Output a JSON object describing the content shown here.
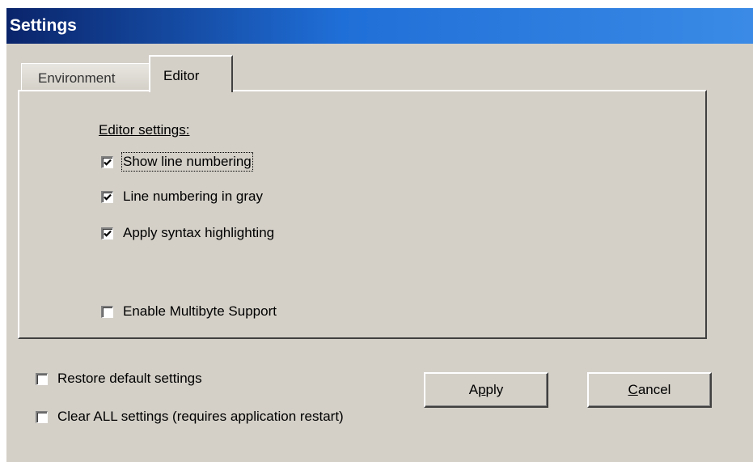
{
  "window": {
    "title": "Settings"
  },
  "tabs": [
    {
      "label": "Environment",
      "selected": false
    },
    {
      "label": "Editor",
      "selected": true
    }
  ],
  "editor_panel": {
    "group_label": "Editor settings:",
    "options": [
      {
        "label": "Show line numbering",
        "checked": true
      },
      {
        "label": "Line numbering in gray",
        "checked": true
      },
      {
        "label": "Apply syntax highlighting",
        "checked": true
      },
      {
        "label": "Enable Multibyte Support",
        "checked": false
      }
    ]
  },
  "bottom_options": [
    {
      "label": "Restore default settings",
      "checked": false
    },
    {
      "label": "Clear ALL settings (requires application restart)",
      "checked": false
    }
  ],
  "buttons": {
    "apply": {
      "label_prefix": "A",
      "label_underlined": "p",
      "label_suffix": "ply"
    },
    "cancel": {
      "label_prefix": "",
      "label_underlined": "C",
      "label_suffix": "ancel"
    }
  },
  "colors": {
    "dialog_bg": "#d4d0c8",
    "title_bar_start": "#0a246a",
    "title_bar_end": "#3a8ae6"
  },
  "icons": {
    "checkmark": "check-icon"
  }
}
